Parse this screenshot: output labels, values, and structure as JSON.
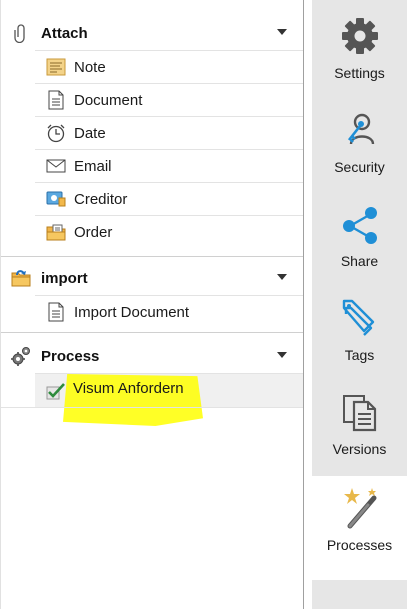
{
  "groups": [
    {
      "label": "Attach",
      "icon": "paperclip-icon",
      "items": [
        {
          "label": "Note",
          "icon": "note-icon"
        },
        {
          "label": "Document",
          "icon": "document-icon"
        },
        {
          "label": "Date",
          "icon": "clock-icon"
        },
        {
          "label": "Email",
          "icon": "envelope-icon"
        },
        {
          "label": "Creditor",
          "icon": "creditor-icon"
        },
        {
          "label": "Order",
          "icon": "order-folder-icon"
        }
      ]
    },
    {
      "label": "import",
      "icon": "import-folder-icon",
      "items": [
        {
          "label": "Import Document",
          "icon": "document-icon"
        }
      ]
    },
    {
      "label": "Process",
      "icon": "process-gears-icon",
      "items": [
        {
          "label": "Visum Anfordern",
          "icon": "checkmark-icon"
        }
      ]
    }
  ],
  "toolbar": {
    "items": [
      {
        "label": "Settings",
        "icon": "gear-icon"
      },
      {
        "label": "Security",
        "icon": "key-person-icon"
      },
      {
        "label": "Share",
        "icon": "share-icon"
      },
      {
        "label": "Tags",
        "icon": "tags-icon"
      },
      {
        "label": "Versions",
        "icon": "versions-icon"
      },
      {
        "label": "Processes",
        "icon": "magic-wand-icon"
      }
    ],
    "active": "Processes"
  },
  "colors": {
    "toolbar_bg": "#e6e6e6",
    "icon_gray": "#555555",
    "icon_blue": "#1f8fd6",
    "highlight": "#ffff00"
  }
}
